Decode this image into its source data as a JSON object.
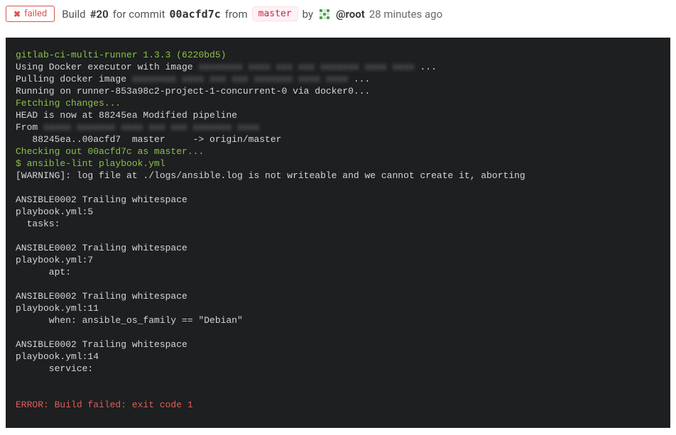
{
  "header": {
    "status_label": "failed",
    "build_word": "Build",
    "build_number": "#20",
    "for_commit_word": "for commit",
    "commit_hash": "00acfd7c",
    "from_word": "from",
    "branch": "master",
    "by_word": "by",
    "author": "@root",
    "time_ago": "28 minutes ago"
  },
  "terminal": {
    "l01_runner": "gitlab-ci-multi-runner 1.3.3 (6220bd5)",
    "l02_pre": "Using Docker executor with image ",
    "l02_blur": "xxxxxxxx xxxx xxx xxx xxxxxxx xxxx xxxx",
    "l02_post": " ...",
    "l03_pre": "Pulling docker image ",
    "l03_blur": "xxxxxxxx xxxx xxx xxx xxxxxxx xxxx xxxx",
    "l03_post": " ...",
    "l04": "Running on runner-853a98c2-project-1-concurrent-0 via docker0...",
    "l05_fetch": "Fetching changes...",
    "l06": "HEAD is now at 88245ea Modified pipeline",
    "l07_pre": "From ",
    "l07_blur": "xxxxx xxxxxxx xxxx xxx xxx xxxxxxx xxxx",
    "l08": "   88245ea..00acfd7  master     -> origin/master",
    "l09_checkout": "Checking out 00acfd7c as master...",
    "l10_cmd": "$ ansible-lint playbook.yml",
    "l11": "[WARNING]: log file at ./logs/ansible.log is not writeable and we cannot create it, aborting",
    "l12": "",
    "l13": "ANSIBLE0002 Trailing whitespace",
    "l14": "playbook.yml:5",
    "l15": "  tasks:",
    "l16": "",
    "l17": "ANSIBLE0002 Trailing whitespace",
    "l18": "playbook.yml:7",
    "l19": "      apt:",
    "l20": "",
    "l21": "ANSIBLE0002 Trailing whitespace",
    "l22": "playbook.yml:11",
    "l23": "      when: ansible_os_family == \"Debian\"",
    "l24": "",
    "l25": "ANSIBLE0002 Trailing whitespace",
    "l26": "playbook.yml:14",
    "l27": "      service:",
    "l28": "",
    "l29": "",
    "l30_error": "ERROR: Build failed: exit code 1"
  }
}
